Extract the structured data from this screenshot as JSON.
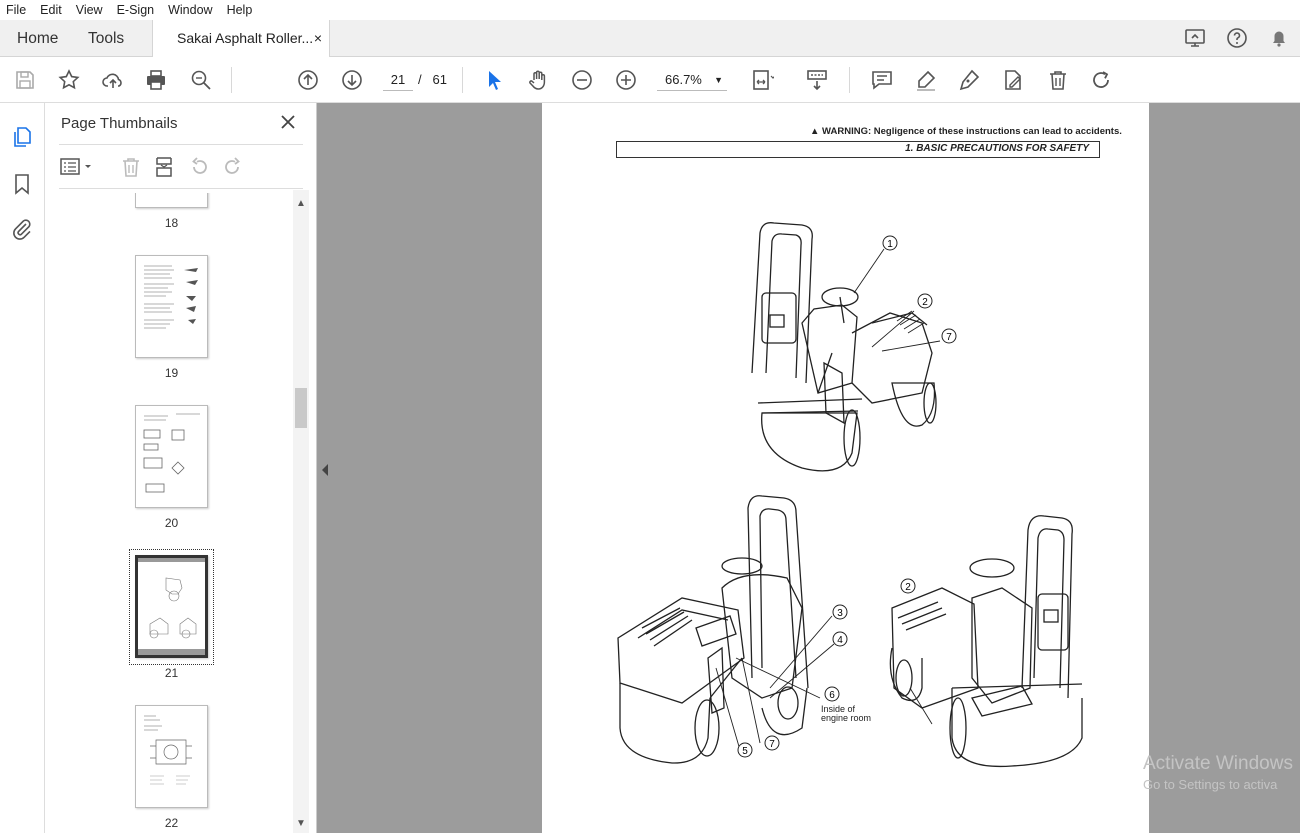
{
  "menu": [
    "File",
    "Edit",
    "View",
    "E-Sign",
    "Window",
    "Help"
  ],
  "tabs": {
    "home": "Home",
    "tools": "Tools",
    "document": "Sakai Asphalt Roller...",
    "close": "×"
  },
  "toolbar": {
    "current_page": "21",
    "page_separator": "/",
    "total_pages": "61",
    "zoom": "66.7%"
  },
  "panel": {
    "title": "Page Thumbnails",
    "thumbnails": [
      {
        "label": "18"
      },
      {
        "label": "19"
      },
      {
        "label": "20"
      },
      {
        "label": "21",
        "selected": true
      },
      {
        "label": "22"
      }
    ]
  },
  "document_page": {
    "warning": "WARNING: Negligence of these instructions can lead to accidents.",
    "section": "1.  BASIC PRECAUTIONS FOR SAFETY",
    "callouts_top": [
      "1",
      "2",
      "7"
    ],
    "callouts_bottom_left": [
      "3",
      "4",
      "6",
      "5",
      "7"
    ],
    "callouts_bottom_right": [
      "2"
    ],
    "caption_line1": "Inside of",
    "caption_line2": "engine room"
  },
  "watermark": {
    "line1": "Activate Windows",
    "line2": "Go to Settings to activa"
  },
  "colors": {
    "accent": "#1a73e8",
    "viewer_bg": "#9c9c9c"
  }
}
